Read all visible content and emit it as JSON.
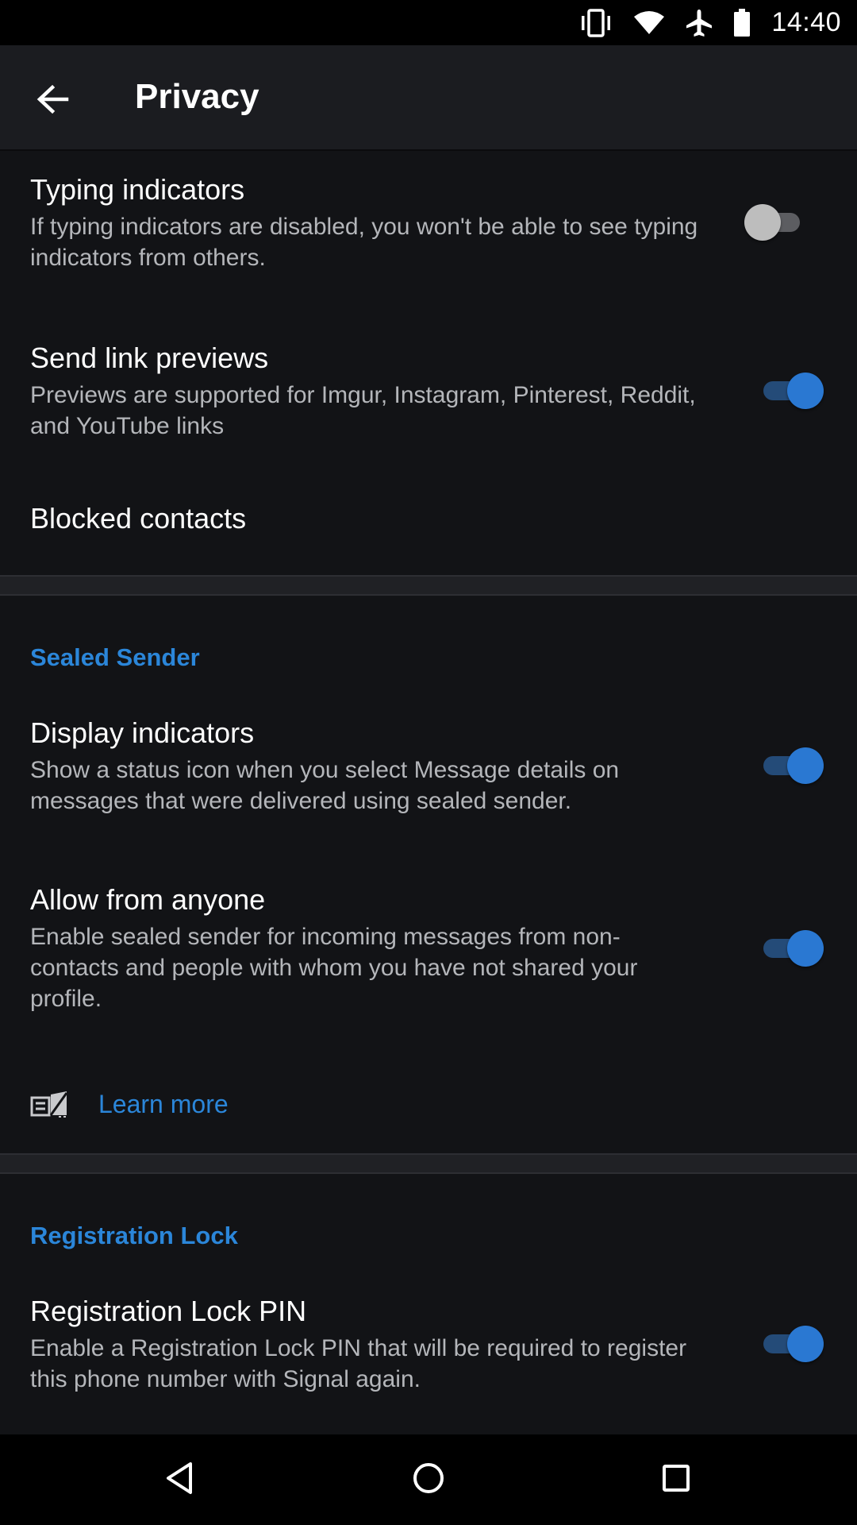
{
  "status_bar": {
    "time": "14:40",
    "icons": [
      "vibrate-icon",
      "wifi-icon",
      "airplane-icon",
      "battery-icon"
    ]
  },
  "app_bar": {
    "title": "Privacy",
    "back_icon": "arrow-back-icon"
  },
  "preferences": {
    "typing_indicators": {
      "title": "Typing indicators",
      "summary": "If typing indicators are disabled, you won't be able to see typing indicators from others.",
      "enabled": false
    },
    "link_previews": {
      "title": "Send link previews",
      "summary": "Previews are supported for Imgur, Instagram, Pinterest, Reddit, and YouTube links",
      "enabled": true
    },
    "blocked_contacts": {
      "title": "Blocked contacts"
    }
  },
  "sealed_sender": {
    "header": "Sealed Sender",
    "display_indicators": {
      "title": "Display indicators",
      "summary": "Show a status icon when you select Message details on messages that were delivered using sealed sender.",
      "enabled": true
    },
    "allow_from_anyone": {
      "title": "Allow from anyone",
      "summary": "Enable sealed sender for incoming messages from non-contacts and people with whom you have not shared your profile.",
      "enabled": true
    },
    "learn_more": {
      "label": "Learn more",
      "icon": "sealed-sender-icon"
    }
  },
  "registration_lock": {
    "header": "Registration Lock",
    "pin": {
      "title": "Registration Lock PIN",
      "summary": "Enable a Registration Lock PIN that will be required to register this phone number with Signal again.",
      "enabled": true
    }
  },
  "nav_bar": {
    "icons": [
      "nav-back-icon",
      "nav-home-icon",
      "nav-recents-icon"
    ]
  },
  "colors": {
    "accent": "#2b86d9",
    "background": "#121316",
    "toolbar": "#1b1c20",
    "switch_on_thumb": "#2a78d2",
    "switch_on_track": "#244b78"
  }
}
